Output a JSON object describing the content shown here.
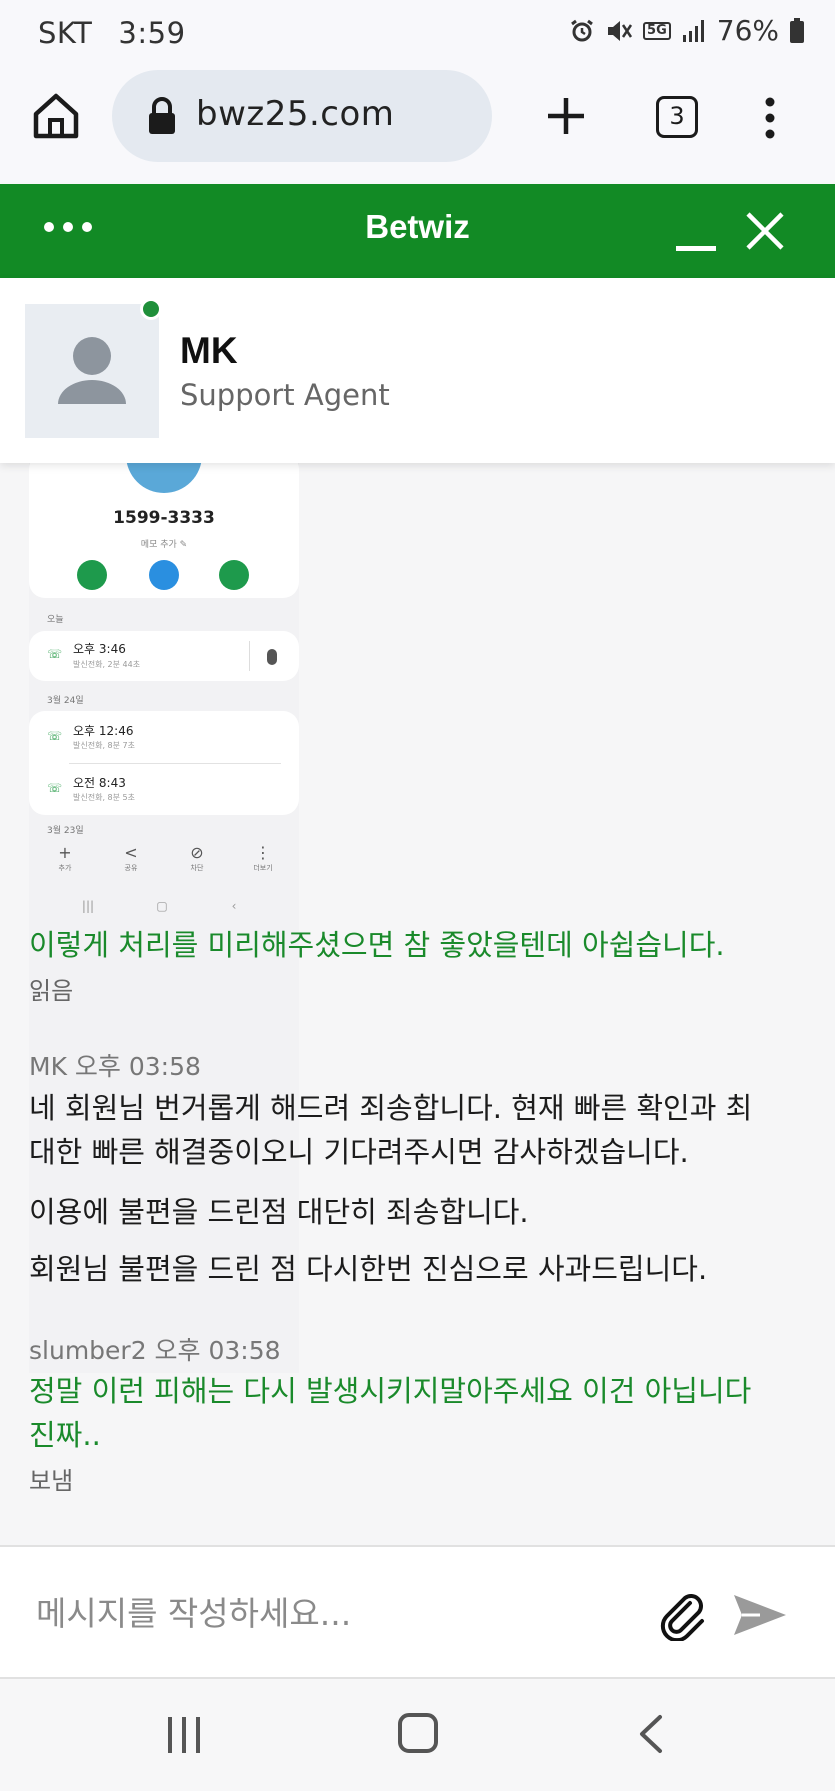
{
  "status_bar": {
    "carrier": "SKT",
    "time": "3:59",
    "network": "5G",
    "battery": "76%"
  },
  "browser": {
    "url": "bwz25.com",
    "tab_count": "3"
  },
  "chat_header": {
    "title": "Betwiz",
    "brand_color": "#128a25"
  },
  "agent": {
    "name": "MK",
    "role": "Support Agent",
    "status_color": "#1f8f3a"
  },
  "screenshot_image": {
    "number": "1599-3333",
    "memo": "메모 추가 ✎",
    "section_today": "오늘",
    "call_1_time": "오후 3:46",
    "call_1_sub": "발신전화, 2분 44초",
    "section_mar24": "3월 24일",
    "call_2_time": "오후 12:46",
    "call_2_sub": "발신전화, 8분 7초",
    "call_3_time": "오전 8:43",
    "call_3_sub": "발신전화, 8분 5초",
    "section_mar23": "3월 23일",
    "tool_add": "추가",
    "tool_share": "공유",
    "tool_block": "차단",
    "tool_more": "더보기"
  },
  "messages": [
    {
      "sender": "",
      "lines": [
        "이렇게 처리를 미리해주셨으면 참 좋았을텐데 아쉽습니다."
      ],
      "status": "읽음"
    },
    {
      "sender": "MK 오후 03:58",
      "lines": [
        "네 회원님 번거롭게 해드려 죄송합니다. 현재 빠른 확인과 최",
        "대한 빠른 해결중이오니 기다려주시면 감사하겠습니다.",
        "이용에 불편을 드린점 대단히 죄송합니다.",
        "회원님 불편을 드린 점 다시한번 진심으로 사과드립니다."
      ]
    },
    {
      "sender": "slumber2 오후 03:58",
      "lines": [
        "정말 이런 피해는 다시 발생시키지말아주세요 이건 아닙니다",
        "진짜.."
      ],
      "status": "보냄"
    }
  ],
  "composer": {
    "placeholder": "메시지를 작성하세요..."
  }
}
